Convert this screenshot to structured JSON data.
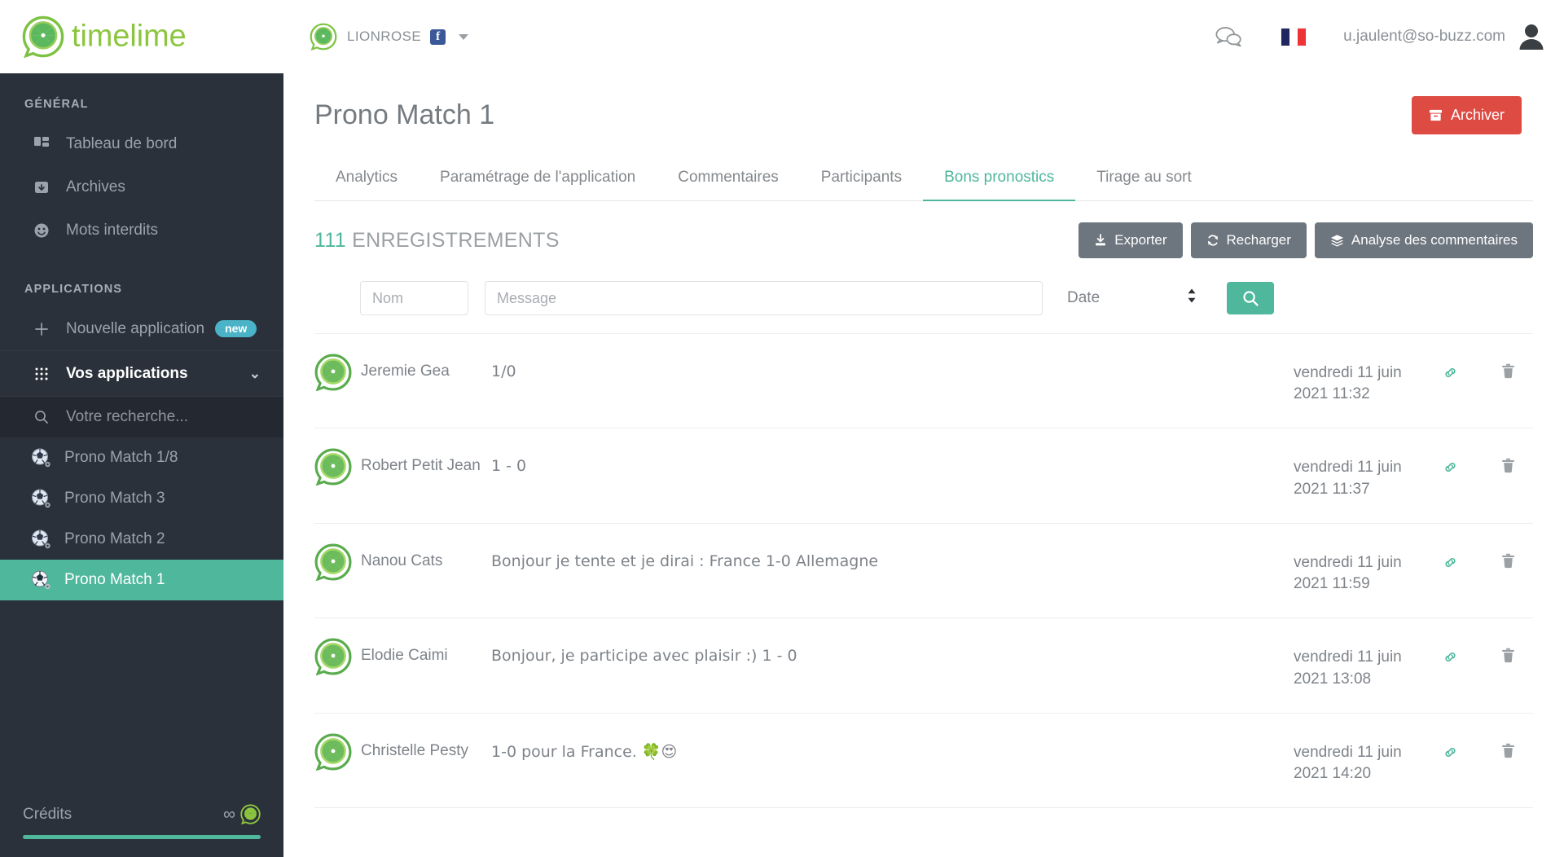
{
  "header": {
    "logo_text": "timelime",
    "brand_name": "LIONROSE",
    "fb_letter": "f",
    "user_email": "u.jaulent@so-buzz.com",
    "icons": {
      "chat": "chat-bubbles-icon",
      "flag": "french-flag-icon",
      "avatar": "user-avatar-icon",
      "caret": "chevron-down-icon"
    }
  },
  "sidebar": {
    "group_general": "GÉNÉRAL",
    "general_items": [
      {
        "label": "Tableau de bord",
        "icon": "dashboard-icon"
      },
      {
        "label": "Archives",
        "icon": "archive-box-icon"
      },
      {
        "label": "Mots interdits",
        "icon": "smiley-icon"
      }
    ],
    "group_applications": "APPLICATIONS",
    "new_app_label": "Nouvelle application",
    "new_badge": "new",
    "your_apps_label": "Vos applications",
    "search_placeholder": "Votre recherche...",
    "search_value": "",
    "apps": [
      {
        "label": "Prono Match 1/8",
        "active": false
      },
      {
        "label": "Prono Match 3",
        "active": false
      },
      {
        "label": "Prono Match 2",
        "active": false
      },
      {
        "label": "Prono Match 1",
        "active": true
      }
    ],
    "credits_label": "Crédits",
    "credits_value": "∞",
    "credits_progress": 100
  },
  "main": {
    "page_title": "Prono Match 1",
    "archive_button": "Archiver",
    "tabs": [
      {
        "label": "Analytics",
        "active": false
      },
      {
        "label": "Paramétrage de l'application",
        "active": false
      },
      {
        "label": "Commentaires",
        "active": false
      },
      {
        "label": "Participants",
        "active": false
      },
      {
        "label": "Bons pronostics",
        "active": true
      },
      {
        "label": "Tirage au sort",
        "active": false
      }
    ],
    "records_number": "111",
    "records_label": "ENREGISTREMENTS",
    "buttons": {
      "export": "Exporter",
      "reload": "Recharger",
      "analysis": "Analyse des commentaires"
    },
    "filters": {
      "nom_placeholder": "Nom",
      "nom_value": "",
      "message_placeholder": "Message",
      "message_value": "",
      "date_label": "Date",
      "search_icon": "search-icon"
    },
    "rows": [
      {
        "name": "Jeremie Gea",
        "message": "1/0",
        "date_line1": "vendredi 11 juin",
        "date_line2": "2021 11:32"
      },
      {
        "name": "Robert Petit Jean",
        "message": "1 - 0",
        "date_line1": "vendredi 11 juin",
        "date_line2": "2021 11:37"
      },
      {
        "name": "Nanou Cats",
        "message": "Bonjour je tente et je dirai : France 1-0 Allemagne",
        "date_line1": "vendredi 11 juin",
        "date_line2": "2021 11:59"
      },
      {
        "name": "Elodie Caimi",
        "message": "Bonjour, je participe avec plaisir :) 1 - 0",
        "date_line1": "vendredi 11 juin",
        "date_line2": "2021 13:08"
      },
      {
        "name": "Christelle Pesty",
        "message": "1-0 pour la France. 🍀😍",
        "date_line1": "vendredi 11 juin",
        "date_line2": "2021 14:20"
      }
    ]
  },
  "colors": {
    "accent": "#4fb79c",
    "sidebar_bg": "#2b313a",
    "danger": "#dd4b43",
    "gray_button": "#6d757e",
    "badge_new": "#4ab3c8"
  }
}
